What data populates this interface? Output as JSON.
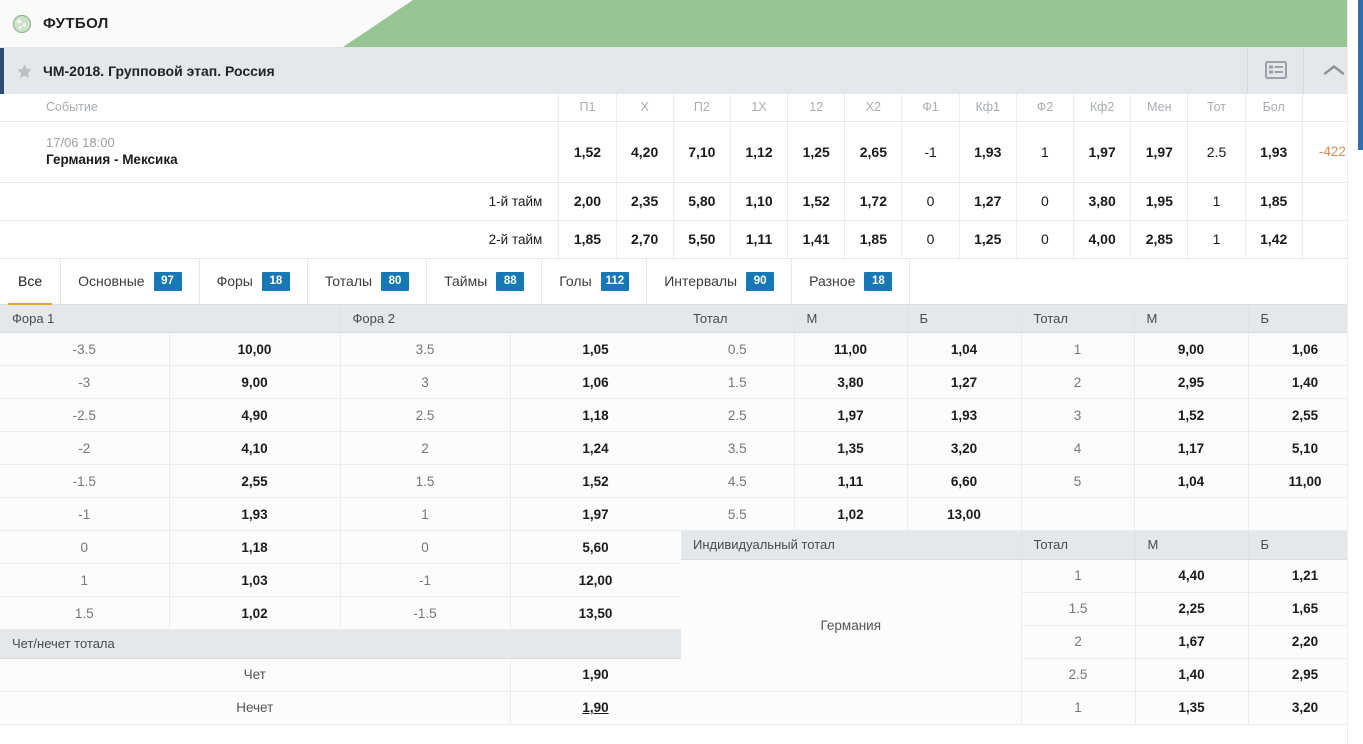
{
  "sportbar": {
    "title": "ФУТБОЛ",
    "icon": "football-icon"
  },
  "league": {
    "title": "ЧМ-2018. Групповой этап. Россия",
    "star_icon": "star-icon",
    "list_icon": "list-view-icon",
    "collapse_icon": "chevron-up-icon"
  },
  "odds_table": {
    "headers": [
      "Событие",
      "П1",
      "X",
      "П2",
      "1X",
      "12",
      "X2",
      "Ф1",
      "Кф1",
      "Ф2",
      "Кф2",
      "Мен",
      "Тот",
      "Бол",
      ""
    ],
    "main_row": {
      "date": "17/06 18:00",
      "teams": "Германия - Мексика",
      "values": [
        "1,52",
        "4,20",
        "7,10",
        "1,12",
        "1,25",
        "2,65",
        "-1",
        "1,93",
        "1",
        "1,97",
        "1,97",
        "2.5",
        "1,93"
      ],
      "more": "-422"
    },
    "sub_rows": [
      {
        "label": "1-й тайм",
        "values": [
          "2,00",
          "2,35",
          "5,80",
          "1,10",
          "1,52",
          "1,72",
          "0",
          "1,27",
          "0",
          "3,80",
          "1,95",
          "1",
          "1,85"
        ],
        "more": ""
      },
      {
        "label": "2-й тайм",
        "values": [
          "1,85",
          "2,70",
          "5,50",
          "1,11",
          "1,41",
          "1,85",
          "0",
          "1,25",
          "0",
          "4,00",
          "2,85",
          "1",
          "1,42"
        ],
        "more": ""
      }
    ]
  },
  "tabs": [
    {
      "label": "Все",
      "badge": "",
      "active": true
    },
    {
      "label": "Основные",
      "badge": "97",
      "active": false
    },
    {
      "label": "Форы",
      "badge": "18",
      "active": false
    },
    {
      "label": "Тоталы",
      "badge": "80",
      "active": false
    },
    {
      "label": "Таймы",
      "badge": "88",
      "active": false
    },
    {
      "label": "Голы",
      "badge": "112",
      "active": false
    },
    {
      "label": "Интервалы",
      "badge": "90",
      "active": false
    },
    {
      "label": "Разное",
      "badge": "18",
      "active": false
    }
  ],
  "fora": {
    "header_left": "Фора 1",
    "header_right": "Фора 2",
    "rows": [
      {
        "l": "-3.5",
        "lv": "10,00",
        "r": "3.5",
        "rv": "1,05"
      },
      {
        "l": "-3",
        "lv": "9,00",
        "r": "3",
        "rv": "1,06"
      },
      {
        "l": "-2.5",
        "lv": "4,90",
        "r": "2.5",
        "rv": "1,18"
      },
      {
        "l": "-2",
        "lv": "4,10",
        "r": "2",
        "rv": "1,24"
      },
      {
        "l": "-1.5",
        "lv": "2,55",
        "r": "1.5",
        "rv": "1,52"
      },
      {
        "l": "-1",
        "lv": "1,93",
        "r": "1",
        "rv": "1,97"
      },
      {
        "l": "0",
        "lv": "1,18",
        "r": "0",
        "rv": "5,60"
      },
      {
        "l": "1",
        "lv": "1,03",
        "r": "-1",
        "rv": "12,00"
      },
      {
        "l": "1.5",
        "lv": "1,02",
        "r": "-1.5",
        "rv": "13,50"
      }
    ]
  },
  "chet_nechet": {
    "header": "Чет/нечет тотала",
    "rows": [
      {
        "label": "Чет",
        "value": "1,90",
        "underline": false
      },
      {
        "label": "Нечет",
        "value": "1,90",
        "underline": true
      }
    ]
  },
  "totals": {
    "headers": [
      "Тотал",
      "М",
      "Б",
      "Тотал",
      "М",
      "Б"
    ],
    "rows": [
      {
        "t1": "0.5",
        "m1": "11,00",
        "b1": "1,04",
        "t2": "1",
        "m2": "9,00",
        "b2": "1,06"
      },
      {
        "t1": "1.5",
        "m1": "3,80",
        "b1": "1,27",
        "t2": "2",
        "m2": "2,95",
        "b2": "1,40"
      },
      {
        "t1": "2.5",
        "m1": "1,97",
        "b1": "1,93",
        "t2": "3",
        "m2": "1,52",
        "b2": "2,55"
      },
      {
        "t1": "3.5",
        "m1": "1,35",
        "b1": "3,20",
        "t2": "4",
        "m2": "1,17",
        "b2": "5,10"
      },
      {
        "t1": "4.5",
        "m1": "1,11",
        "b1": "6,60",
        "t2": "5",
        "m2": "1,04",
        "b2": "11,00"
      },
      {
        "t1": "5.5",
        "m1": "1,02",
        "b1": "13,00",
        "t2": "",
        "m2": "",
        "b2": ""
      }
    ]
  },
  "individual_total": {
    "headers": [
      "Индивидуальный тотал",
      "Тотал",
      "М",
      "Б"
    ],
    "team": "Германия",
    "rows": [
      {
        "t": "1",
        "m": "4,40",
        "b": "1,21"
      },
      {
        "t": "1.5",
        "m": "2,25",
        "b": "1,65"
      },
      {
        "t": "2",
        "m": "1,67",
        "b": "2,20"
      },
      {
        "t": "2.5",
        "m": "1,40",
        "b": "2,95"
      },
      {
        "t": "1",
        "m": "1,35",
        "b": "3,20"
      }
    ]
  },
  "colors": {
    "green_banner": "#96c493",
    "league_band": "#e4e8eb",
    "accent_left": "#2d4b76",
    "badge": "#1678b4",
    "active_tab_underline": "#e8a33d",
    "more_link": "#d98c57",
    "scroll_thumb": "#2f6fad"
  }
}
